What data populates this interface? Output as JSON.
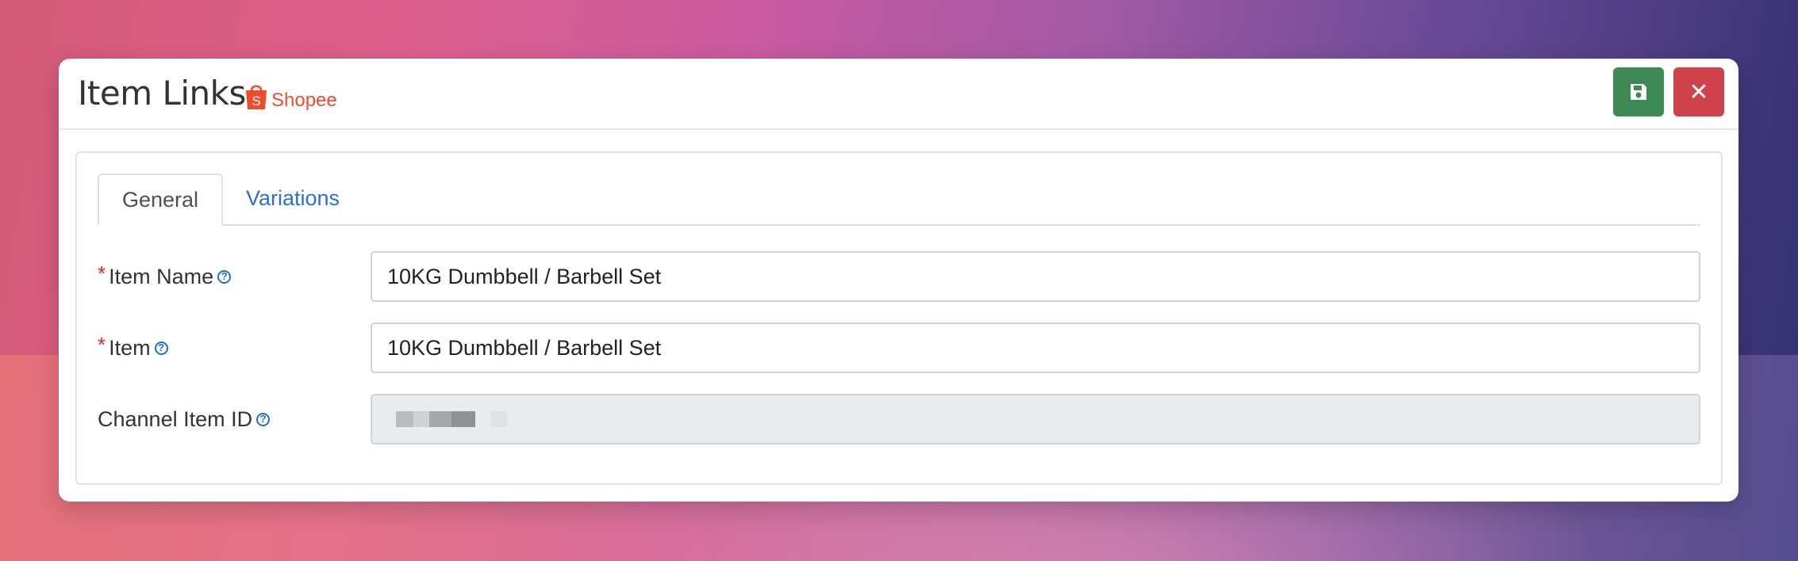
{
  "modal": {
    "title": "Item Links",
    "brand": "Shopee",
    "brand_badge": "S",
    "brand_color": "#ee4d2d",
    "actions": {
      "save_icon": "floppy-disk-icon",
      "close_icon": "close-icon",
      "close_glyph": "✕"
    }
  },
  "tabs": [
    {
      "label": "General",
      "active": true
    },
    {
      "label": "Variations",
      "active": false
    }
  ],
  "form": {
    "item_name": {
      "label": "Item Name",
      "required": true,
      "value": "10KG Dumbbell / Barbell Set"
    },
    "item": {
      "label": "Item",
      "required": true,
      "value": "10KG Dumbbell / Barbell Set"
    },
    "channel_item_id": {
      "label": "Channel Item ID",
      "required": false,
      "value": "",
      "disabled": true
    }
  },
  "symbols": {
    "required": "*",
    "help": "?"
  },
  "colors": {
    "save": "#3d8a55",
    "close": "#d0424a",
    "tab_active_link": "#2a6fd6"
  }
}
